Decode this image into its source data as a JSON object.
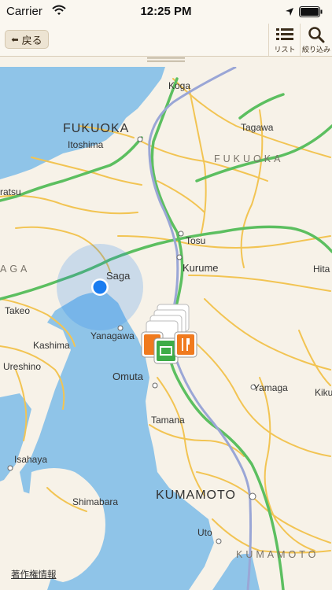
{
  "status_bar": {
    "carrier": "Carrier",
    "time": "12:25 PM"
  },
  "toolbar": {
    "back_label": "戻る",
    "list_label": "リスト",
    "filter_label": "絞り込み"
  },
  "map": {
    "labels": {
      "koga": "Koga",
      "fukuoka_city": "FUKUOKA",
      "itoshima": "Itoshima",
      "tagawa": "Tagawa",
      "fukuoka_pref": "FUKUOKA",
      "ratsu": "ratsu",
      "tosu": "Tosu",
      "aga": "AGA",
      "saga": "Saga",
      "kurume": "Kurume",
      "hita": "Hita",
      "takeo": "Takeo",
      "yanagawa": "Yanagawa",
      "kashima": "Kashima",
      "ureshino": "Ureshino",
      "omuta": "Omuta",
      "yamaga": "Yamaga",
      "kiku": "Kiku",
      "tamana": "Tamana",
      "isahaya": "Isahaya",
      "shimabara": "Shimabara",
      "kumamoto_city": "KUMAMOTO",
      "uto": "Uto",
      "kumamoto_pref": "KUMAMOTO"
    }
  },
  "copyright": "著作権情報",
  "colors": {
    "water": "#8fc4e8",
    "land": "#f7f2e8",
    "expressway": "#5cbf60",
    "rail": "#9aa6d6",
    "road": "#f2c453",
    "user": "#1a7cf0"
  }
}
